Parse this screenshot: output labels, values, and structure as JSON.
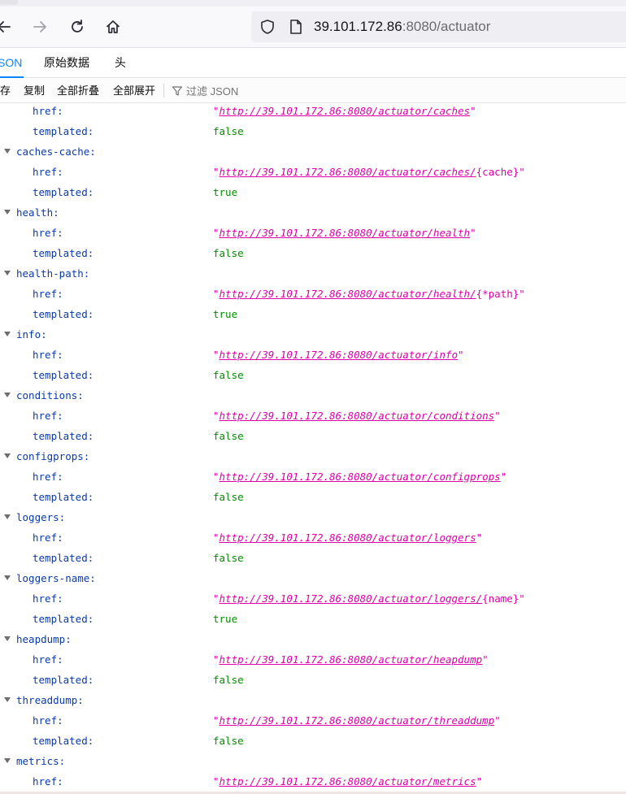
{
  "browser": {
    "url_host": "39.101.172.86",
    "url_rest": ":8080/actuator"
  },
  "viewer": {
    "tabs": [
      "JSON",
      "原始数据",
      "头"
    ],
    "toolbar": [
      "保存",
      "复制",
      "全部折叠",
      "全部展开"
    ],
    "filter_placeholder": "过滤 JSON"
  },
  "tree": [
    {
      "type": "prop",
      "key": "href:",
      "kind": "url",
      "link": "http://39.101.172.86:8080/actuator/caches",
      "suffix": ""
    },
    {
      "type": "prop",
      "key": "templated:",
      "kind": "bool",
      "value": "false"
    },
    {
      "type": "group",
      "key": "caches-cache:"
    },
    {
      "type": "prop",
      "key": "href:",
      "kind": "url",
      "link": "http://39.101.172.86:8080/actuator/caches/",
      "suffix": "{cache}"
    },
    {
      "type": "prop",
      "key": "templated:",
      "kind": "bool",
      "value": "true"
    },
    {
      "type": "group",
      "key": "health:"
    },
    {
      "type": "prop",
      "key": "href:",
      "kind": "url",
      "link": "http://39.101.172.86:8080/actuator/health",
      "suffix": ""
    },
    {
      "type": "prop",
      "key": "templated:",
      "kind": "bool",
      "value": "false"
    },
    {
      "type": "group",
      "key": "health-path:"
    },
    {
      "type": "prop",
      "key": "href:",
      "kind": "url",
      "link": "http://39.101.172.86:8080/actuator/health/",
      "suffix": "{*path}"
    },
    {
      "type": "prop",
      "key": "templated:",
      "kind": "bool",
      "value": "true"
    },
    {
      "type": "group",
      "key": "info:"
    },
    {
      "type": "prop",
      "key": "href:",
      "kind": "url",
      "link": "http://39.101.172.86:8080/actuator/info",
      "suffix": ""
    },
    {
      "type": "prop",
      "key": "templated:",
      "kind": "bool",
      "value": "false"
    },
    {
      "type": "group",
      "key": "conditions:"
    },
    {
      "type": "prop",
      "key": "href:",
      "kind": "url",
      "link": "http://39.101.172.86:8080/actuator/conditions",
      "suffix": ""
    },
    {
      "type": "prop",
      "key": "templated:",
      "kind": "bool",
      "value": "false"
    },
    {
      "type": "group",
      "key": "configprops:"
    },
    {
      "type": "prop",
      "key": "href:",
      "kind": "url",
      "link": "http://39.101.172.86:8080/actuator/configprops",
      "suffix": ""
    },
    {
      "type": "prop",
      "key": "templated:",
      "kind": "bool",
      "value": "false"
    },
    {
      "type": "group",
      "key": "loggers:"
    },
    {
      "type": "prop",
      "key": "href:",
      "kind": "url",
      "link": "http://39.101.172.86:8080/actuator/loggers",
      "suffix": ""
    },
    {
      "type": "prop",
      "key": "templated:",
      "kind": "bool",
      "value": "false"
    },
    {
      "type": "group",
      "key": "loggers-name:"
    },
    {
      "type": "prop",
      "key": "href:",
      "kind": "url",
      "link": "http://39.101.172.86:8080/actuator/loggers/",
      "suffix": "{name}"
    },
    {
      "type": "prop",
      "key": "templated:",
      "kind": "bool",
      "value": "true"
    },
    {
      "type": "group",
      "key": "heapdump:"
    },
    {
      "type": "prop",
      "key": "href:",
      "kind": "url",
      "link": "http://39.101.172.86:8080/actuator/heapdump",
      "suffix": ""
    },
    {
      "type": "prop",
      "key": "templated:",
      "kind": "bool",
      "value": "false"
    },
    {
      "type": "group",
      "key": "threaddump:"
    },
    {
      "type": "prop",
      "key": "href:",
      "kind": "url",
      "link": "http://39.101.172.86:8080/actuator/threaddump",
      "suffix": ""
    },
    {
      "type": "prop",
      "key": "templated:",
      "kind": "bool",
      "value": "false"
    },
    {
      "type": "group",
      "key": "metrics:"
    },
    {
      "type": "prop",
      "key": "href:",
      "kind": "url",
      "link": "http://39.101.172.86:8080/actuator/metrics",
      "suffix": ""
    }
  ]
}
